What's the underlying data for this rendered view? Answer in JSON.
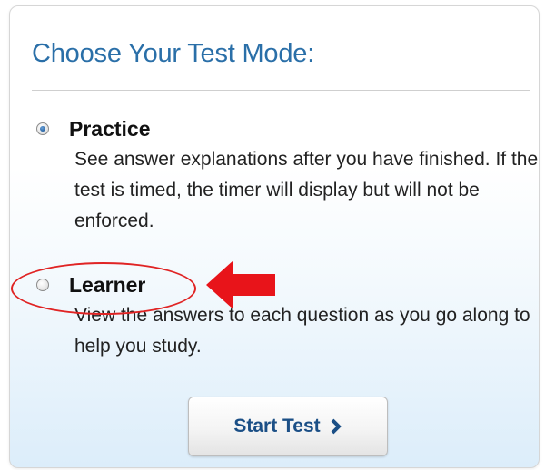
{
  "panel": {
    "title": "Choose Your Test Mode:",
    "title_color": "#2a6fa8"
  },
  "options": [
    {
      "label": "Practice",
      "description": "See answer explanations after you have finished. If the test is timed, the timer will display but will not be enforced.",
      "selected": true
    },
    {
      "label": "Learner",
      "description": "View the answers to each question as you go along to help you study.",
      "selected": false
    }
  ],
  "annotation": {
    "color": "#e02424",
    "ellipse_target": "Learner",
    "arrow_icon": "left-arrow-icon"
  },
  "start_button": {
    "label": "Start Test",
    "icon": "chevron-right-icon",
    "color": "#1b4f86"
  }
}
